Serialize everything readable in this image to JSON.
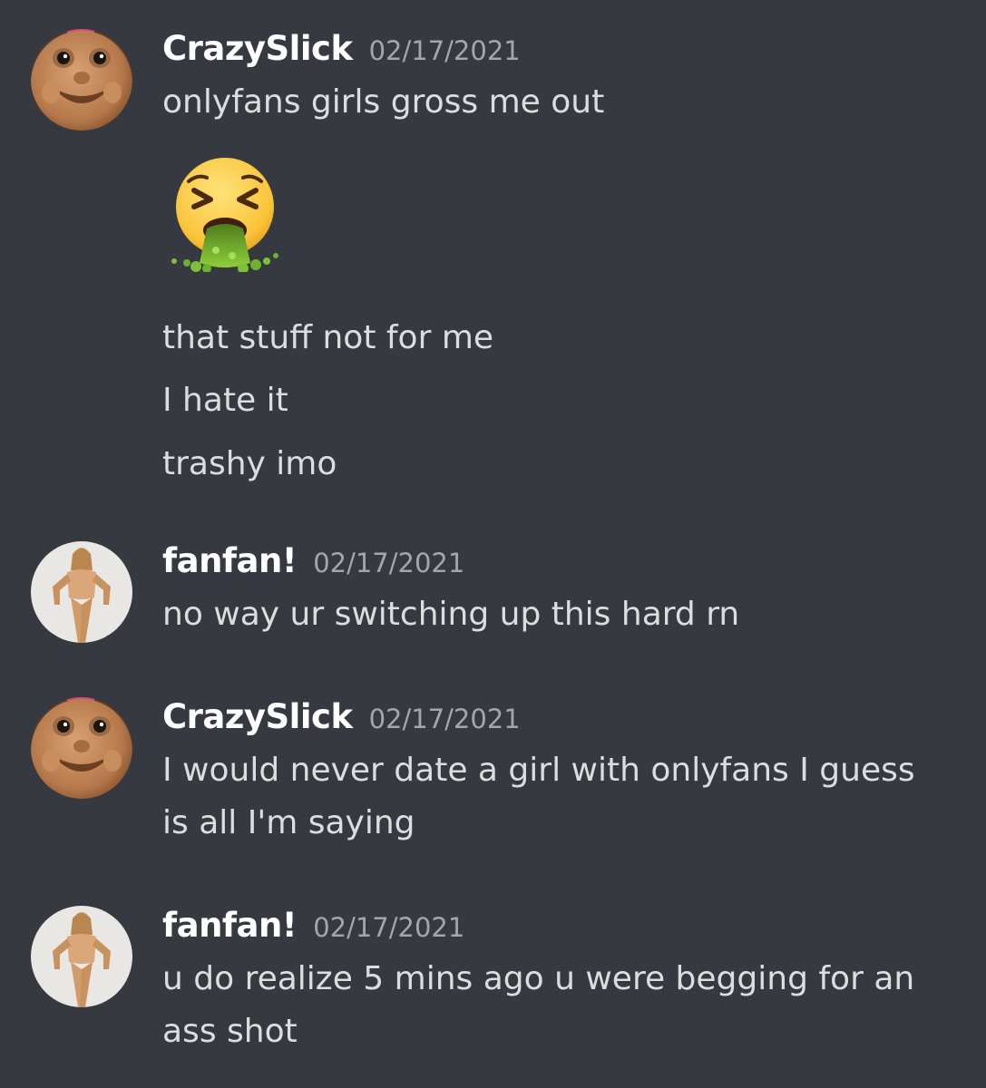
{
  "messages": [
    {
      "username": "CrazySlick",
      "timestamp": "02/17/2021",
      "avatar": "troll-doll-avatar",
      "lines": [
        "onlyfans girls gross me out"
      ],
      "emoji": "vomiting-face-emoji",
      "more_lines": [
        "that stuff not for me",
        "I hate it",
        "trashy imo"
      ]
    },
    {
      "username": "fanfan!",
      "timestamp": "02/17/2021",
      "avatar": "doll-figure-avatar",
      "lines": [
        "no way ur switching up this hard rn"
      ]
    },
    {
      "username": "CrazySlick",
      "timestamp": "02/17/2021",
      "avatar": "troll-doll-avatar",
      "lines": [
        "I would never date a girl with onlyfans I guess",
        "is all I'm saying"
      ]
    },
    {
      "username": "fanfan!",
      "timestamp": "02/17/2021",
      "avatar": "doll-figure-avatar",
      "lines": [
        "u do realize 5 mins ago u were begging for an",
        "ass shot"
      ]
    }
  ],
  "colors": {
    "background": "#36393f",
    "username": "#ffffff",
    "timestamp": "#a3a6aa",
    "text": "#dcddde"
  }
}
